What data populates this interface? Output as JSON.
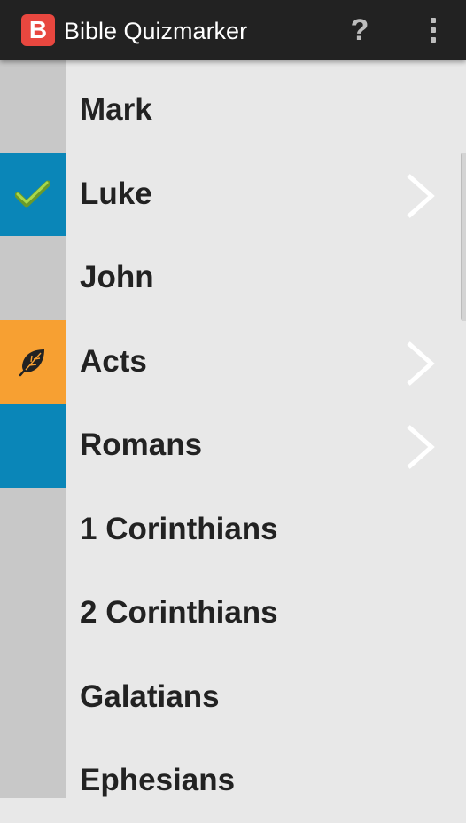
{
  "app": {
    "title": "Bible Quizmarker",
    "icon_letter": "B",
    "icon": "app-logo-icon",
    "help_label": "?",
    "overflow_icon": "overflow-menu-icon"
  },
  "colors": {
    "action_bar": "#222222",
    "app_icon": "#e8473f",
    "blue_marker": "#0a86b8",
    "orange_marker": "#f7a032",
    "strip": "#c8c8c8",
    "background": "#e8e8e8"
  },
  "books": [
    {
      "label": "Mark",
      "marker": "none",
      "icon": "",
      "chevron": false
    },
    {
      "label": "Luke",
      "marker": "blue",
      "icon": "checkmark-icon",
      "chevron": true
    },
    {
      "label": "John",
      "marker": "none",
      "icon": "",
      "chevron": false
    },
    {
      "label": "Acts",
      "marker": "orange",
      "icon": "leaf-icon",
      "chevron": true
    },
    {
      "label": "Romans",
      "marker": "blue",
      "icon": "",
      "chevron": true
    },
    {
      "label": "1 Corinthians",
      "marker": "none",
      "icon": "",
      "chevron": false
    },
    {
      "label": "2 Corinthians",
      "marker": "none",
      "icon": "",
      "chevron": false
    },
    {
      "label": "Galatians",
      "marker": "none",
      "icon": "",
      "chevron": false
    },
    {
      "label": "Ephesians",
      "marker": "none",
      "icon": "",
      "chevron": false
    }
  ]
}
